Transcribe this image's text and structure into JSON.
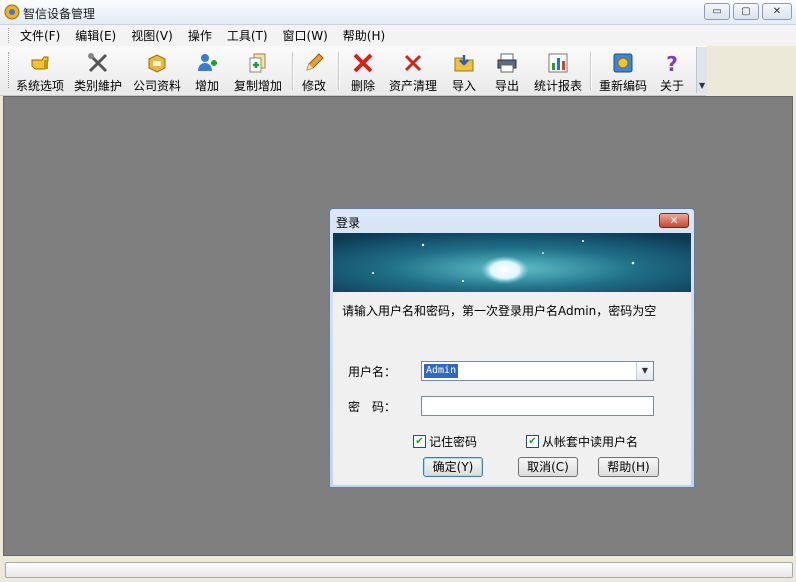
{
  "window": {
    "title": "智信设备管理",
    "min_label": "▭",
    "max_label": "▢",
    "close_label": "✕"
  },
  "menu": [
    "文件(F)",
    "编辑(E)",
    "视图(V)",
    "操作",
    "工具(T)",
    "窗口(W)",
    "帮助(H)"
  ],
  "toolbar": {
    "buttons": [
      {
        "label": "系统选项",
        "icon": "pointing-hand-icon"
      },
      {
        "label": "类别維护",
        "icon": "tools-icon"
      },
      {
        "label": "公司资料",
        "icon": "company-file-icon"
      },
      {
        "label": "增加",
        "icon": "add-user-icon"
      },
      {
        "label": "复制增加",
        "icon": "copy-add-icon"
      },
      {
        "label": "修改",
        "icon": "pencil-icon"
      },
      {
        "label": "删除",
        "icon": "delete-x-icon"
      },
      {
        "label": "资产清理",
        "icon": "clear-x-icon"
      },
      {
        "label": "导入",
        "icon": "import-folder-icon"
      },
      {
        "label": "导出",
        "icon": "export-printer-icon"
      },
      {
        "label": "统计报表",
        "icon": "chart-report-icon"
      },
      {
        "label": "重新编码",
        "icon": "recode-gear-icon"
      },
      {
        "label": "关于",
        "icon": "question-icon"
      }
    ]
  },
  "login": {
    "title": "登录",
    "hint": "请输入用户名和密码，第一次登录用户名Admin，密码为空",
    "username_label": "用户名：",
    "username_value": "Admin",
    "password_label": "密　码：",
    "password_value": "",
    "remember_label": "记住密码",
    "remember_checked": true,
    "read_from_account_label": "从帐套中读用户名",
    "read_from_account_checked": true,
    "ok_label": "确定(Y)",
    "cancel_label": "取消(C)",
    "help_label": "帮助(H)"
  },
  "colors": {
    "workspace": "#7f7f7f",
    "banner": "#1f6f86",
    "selection": "#3168c6"
  }
}
